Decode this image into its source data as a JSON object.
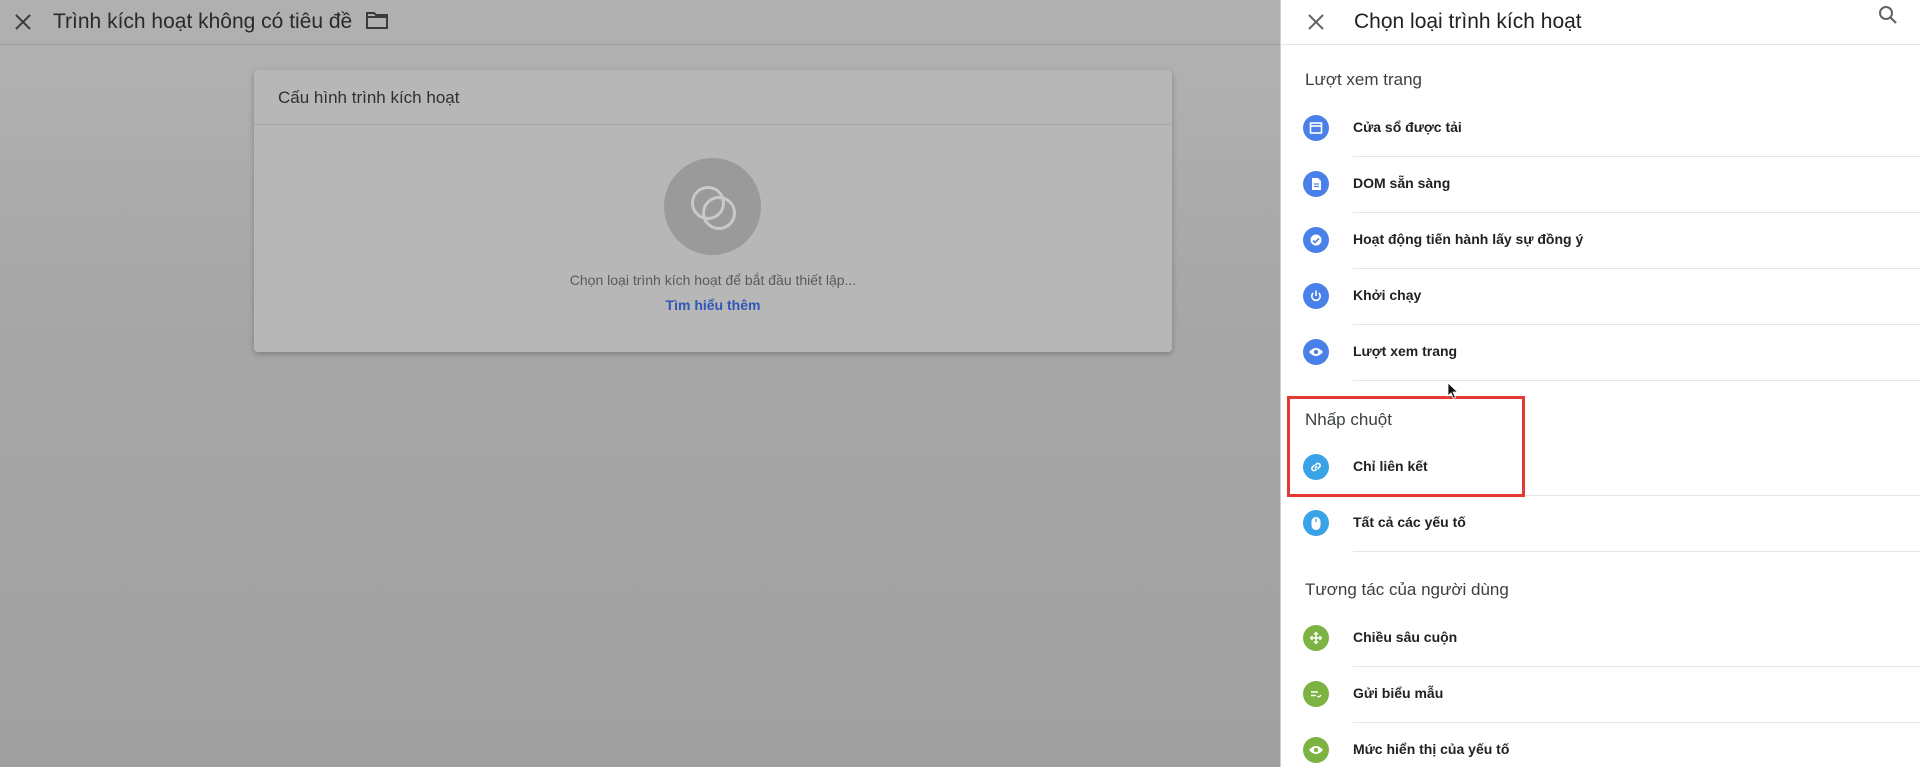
{
  "editor": {
    "title": "Trình kích hoạt không có tiêu đề",
    "card": {
      "title": "Cấu hình trình kích hoạt",
      "hint": "Chọn loại trình kích hoạt để bắt đầu thiết lập...",
      "learn_more": "Tìm hiểu thêm"
    }
  },
  "panel": {
    "title": "Chọn loại trình kích hoạt",
    "sections": [
      {
        "title": "Lượt xem trang",
        "items": [
          {
            "label": "Cửa sổ được tải",
            "icon": "window-icon",
            "color": "#4a81e8"
          },
          {
            "label": "DOM sẵn sàng",
            "icon": "document-icon",
            "color": "#4a81e8"
          },
          {
            "label": "Hoạt động tiến hành lấy sự đồng ý",
            "icon": "consent-shield-icon",
            "color": "#4a81e8"
          },
          {
            "label": "Khởi chạy",
            "icon": "power-icon",
            "color": "#4a81e8"
          },
          {
            "label": "Lượt xem trang",
            "icon": "eye-icon",
            "color": "#4a81e8"
          }
        ]
      },
      {
        "title": "Nhấp chuột",
        "items": [
          {
            "label": "Chỉ liên kết",
            "icon": "link-icon",
            "color": "#3aa3e8"
          },
          {
            "label": "Tất cả các yếu tố",
            "icon": "mouse-icon",
            "color": "#3aa3e8"
          }
        ]
      },
      {
        "title": "Tương tác của người dùng",
        "items": [
          {
            "label": "Chiều sâu cuộn",
            "icon": "scroll-move-icon",
            "color": "#7cb342"
          },
          {
            "label": "Gửi biểu mẫu",
            "icon": "form-icon",
            "color": "#7cb342"
          },
          {
            "label": "Mức hiển thị của yếu tố",
            "icon": "eye-icon",
            "color": "#7cb342"
          }
        ]
      }
    ]
  },
  "highlight_color": "#e53935"
}
